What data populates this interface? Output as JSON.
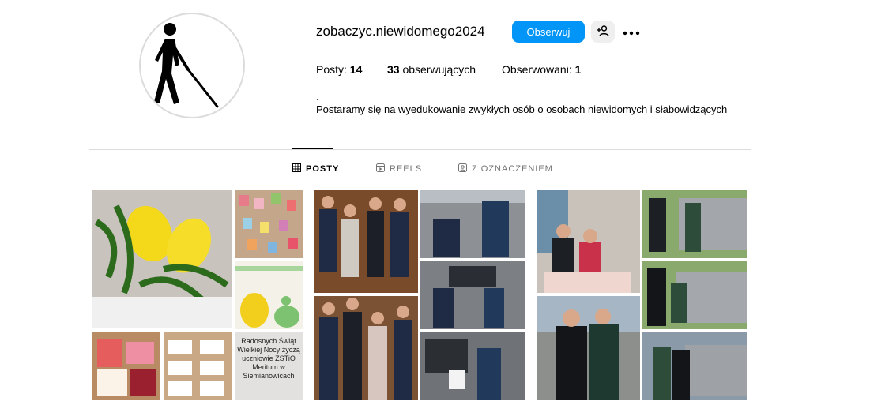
{
  "profile": {
    "username": "zobaczyc.niewidomego2024",
    "follow_label": "Obserwuj",
    "stats": {
      "posts_label": "Posty:",
      "posts_value": "14",
      "followers_value": "33",
      "followers_label": "obserwujących",
      "following_label": "Obserwowani:",
      "following_value": "1"
    },
    "bio_line1": ".",
    "bio_line2": "Postaramy się na wyedukowanie zwykłych osób o osobach niewidomych i słabowidzących"
  },
  "tabs": [
    {
      "label": "POSTY",
      "icon": "grid-icon",
      "active": true
    },
    {
      "label": "REELS",
      "icon": "reels-icon",
      "active": false
    },
    {
      "label": "Z OZNACZENIEM",
      "icon": "tagged-icon",
      "active": false
    }
  ],
  "posts": [
    {
      "photo_text": "Radosnych Świąt Wielkiej Nocy życzą uczniowie ZSTiO Meritum w Siemianowicach"
    }
  ],
  "colors": {
    "accent": "#0095f6",
    "divider": "#dbdbdb",
    "muted": "#737373"
  }
}
